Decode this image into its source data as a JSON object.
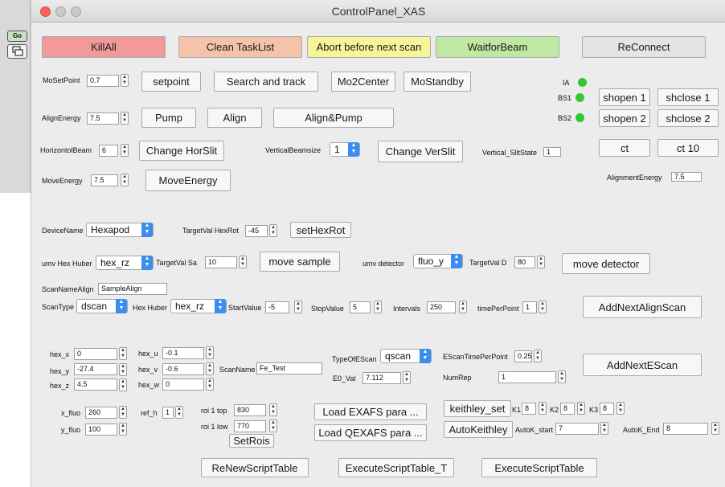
{
  "window": {
    "title": "ControlPanel_XAS"
  },
  "left_panel": {
    "button1": "Go"
  },
  "top_buttons": {
    "killall": "KillAll",
    "clean": "Clean TaskList",
    "abort": "Abort before next scan",
    "waitbeam": "WaitforBeam",
    "reconnect": "ReConnect"
  },
  "colors": {
    "killall": "#f29a9a",
    "clean": "#f5c2aa",
    "abort": "#f7f59a",
    "waitbeam": "#bfe8a2",
    "led": "#32c832",
    "select_arrow": "#3b8ef0"
  },
  "row1": {
    "mosetpoint_label": "MoSetPoint",
    "mosetpoint_value": "0.7",
    "setpoint": "setpoint",
    "search": "Search and track",
    "mo2center": "Mo2Center",
    "mostandby": "MoStandby"
  },
  "status": {
    "ia": "IA",
    "bs1": "BS1",
    "bs2": "BS2"
  },
  "shutters": {
    "shopen1": "shopen 1",
    "shclose1": "shclose 1",
    "shopen2": "shopen 2",
    "shclose2": "shclose 2",
    "ct": "ct",
    "ct10": "ct 10"
  },
  "row2": {
    "alignenergy_label": "AlignEnergy",
    "alignenergy_value": "7.5",
    "pump": "Pump",
    "align": "Align",
    "alignpump": "Align&Pump"
  },
  "row3": {
    "horbeam_label": "HorizontolBeam",
    "horbeam_value": "6",
    "change_hor": "Change HorSlit",
    "vertbeam_label": "VerticalBeamsize",
    "vertbeam_value": "1",
    "change_ver": "Change VerSlit",
    "vslitstate_label": "Vertical_SlitState",
    "vslitstate_value": "1"
  },
  "row4": {
    "moveenergy_label": "MoveEnergy",
    "moveenergy_value": "7.5",
    "moveenergy_btn": "MoveEnergy",
    "alignmentenergy_label": "AlignmentEnergy",
    "alignmentenergy_value": "7.5"
  },
  "device": {
    "name_label": "DeviceName",
    "name_value": "Hexapod",
    "target_label": "TargetVal HexRot",
    "target_value": "-45",
    "sethexrot": "setHexRot"
  },
  "umv": {
    "huber_label": "umv Hex Huber",
    "huber_value": "hex_rz",
    "targetsa_label": "TargetVal Sa",
    "targetsa_value": "10",
    "move_sample": "move sample",
    "detector_label": "umv detector",
    "detector_value": "fluo_y",
    "targetd_label": "TargetVal D",
    "targetd_value": "80",
    "move_detector": "move detector"
  },
  "scanalign": {
    "name_label": "ScanNameAlign",
    "name_value": "SampleAlign",
    "type_label": "ScanType",
    "type_value": "dscan",
    "huber_label": "Hex Huber",
    "huber_value": "hex_rz",
    "start_label": "StartValue",
    "start_value": "-5",
    "stop_label": "StopValue",
    "stop_value": "5",
    "intervals_label": "Intervals",
    "intervals_value": "250",
    "tpp_label": "timePerPoint",
    "tpp_value": "1",
    "add": "AddNextAlignScan"
  },
  "hex": {
    "x_label": "hex_x",
    "x_value": "0",
    "y_label": "hex_y",
    "y_value": "-27.4",
    "z_label": "hex_z",
    "z_value": "4.5",
    "u_label": "hex_u",
    "u_value": "-0.1",
    "v_label": "hex_v",
    "v_value": "-0.6",
    "w_label": "hex_w",
    "w_value": "0"
  },
  "escan": {
    "scanname_label": "ScanName",
    "scanname_value": "Fe_Test",
    "type_label": "TypeOfEScan",
    "type_value": "qscan",
    "e0_label": "E0_Val",
    "e0_value": "7.112",
    "tpp_label": "EScanTimePerPoint",
    "tpp_value": "0.25",
    "numrep_label": "NumRep",
    "numrep_value": "1",
    "add": "AddNextEScan"
  },
  "fluo": {
    "xfluo_label": "x_fluo",
    "xfluo_value": "260",
    "yfluo_label": "y_fluo",
    "yfluo_value": "100",
    "refh_label": "ref_h",
    "refh_value": "1",
    "roitop_label": "roi 1 top",
    "roitop_value": "830",
    "roilow_label": "roi 1 low",
    "roilow_value": "770",
    "setrois": "SetRois",
    "load_exafs": "Load EXAFS para ...",
    "load_qexafs": "Load QEXAFS para ..."
  },
  "keithley": {
    "set": "keithley_set",
    "k1_label": "K1",
    "k1_value": "8",
    "k2_label": "K2",
    "k2_value": "8",
    "k3_label": "K3",
    "k3_value": "8",
    "auto": "AutoKeithley",
    "autostart_label": "AutoK_start",
    "autostart_value": "7",
    "autoend_label": "AutoK_End",
    "autoend_value": "8"
  },
  "bottom": {
    "renew": "ReNewScriptTable",
    "execute_t": "ExecuteScriptTable_T",
    "execute": "ExecuteScriptTable"
  }
}
